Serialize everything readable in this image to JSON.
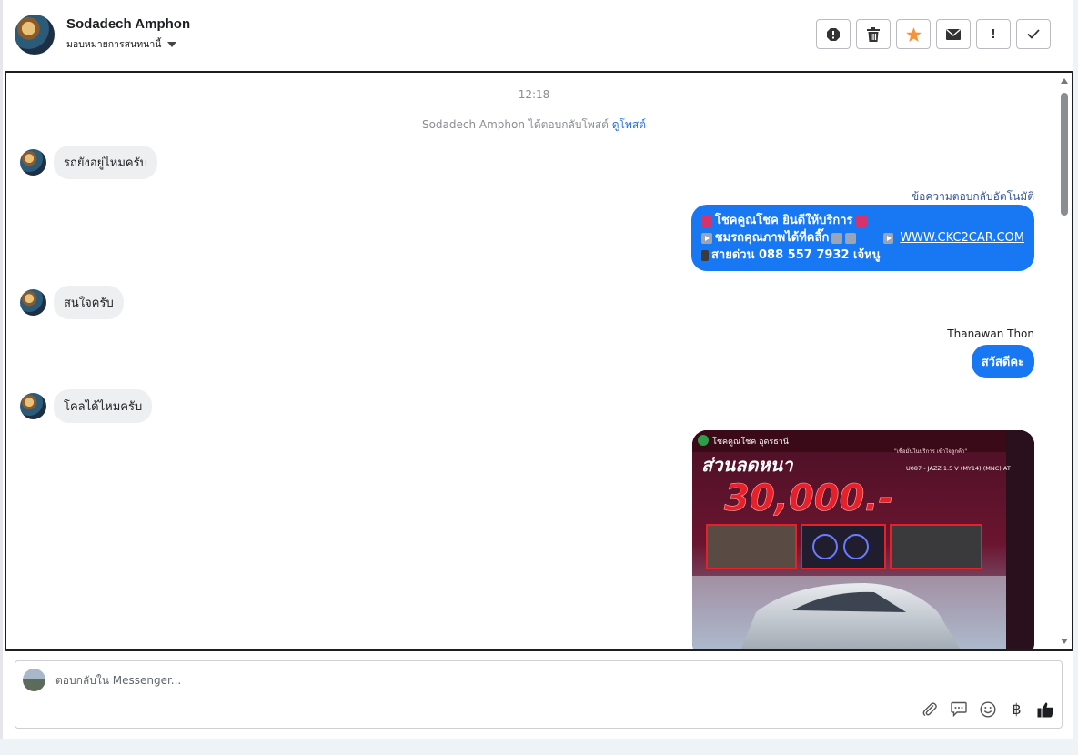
{
  "header": {
    "name": "Sodadech Amphon",
    "assign_label": "มอบหมายการสนทนานี้",
    "toolbar": [
      "spam-icon",
      "trash-icon",
      "star-icon",
      "envelope-icon",
      "exclamation-icon",
      "check-icon"
    ],
    "important_glyph": "!"
  },
  "conversation": {
    "timestamp": "12:18",
    "system_note": "Sodadech Amphon ได้ตอบกลับโพสต์",
    "system_note_link": "ดูโพสต์",
    "messages": {
      "m1": "รถยังอยู่ไหมครับ",
      "m2": "สนใจครับ",
      "m3": "โคลได้ไหมครับ"
    },
    "auto_reply": {
      "label": "ข้อความตอบกลับอัตโนมัติ",
      "line1": "โชคคูณโชค ยินดีให้บริการ",
      "line2": "ชมรถคุณภาพได้ที่คลิ๊ก",
      "link": "WWW.CKC2CAR.COM",
      "line3": "สายด่วน 088 557 7932 เจ้หนู"
    },
    "agent_reply": {
      "sender": "Thanawan Thon",
      "text": "สวัสดีคะ"
    },
    "image_message": {
      "brand_text": "โชคคูณโชค อุดรธานี",
      "tagline": "\"เชื่อมั่นในบริการ เข้าใจลูกค้า\"",
      "headline": "ส่วนลดหนา",
      "discount": "30,000.-",
      "model": "U087 - JAZZ 1.5 V (MY14) (MNC) AT"
    }
  },
  "composer": {
    "placeholder": "ตอบกลับใน Messenger...",
    "tools": [
      "paperclip-icon",
      "saved-reply-icon",
      "emoji-icon",
      "baht-icon",
      "thumbs-up-icon"
    ],
    "baht_symbol": "฿"
  },
  "colors": {
    "accent": "#1877f2",
    "bubble_in": "#eeeff1",
    "star": "#f7923a"
  }
}
